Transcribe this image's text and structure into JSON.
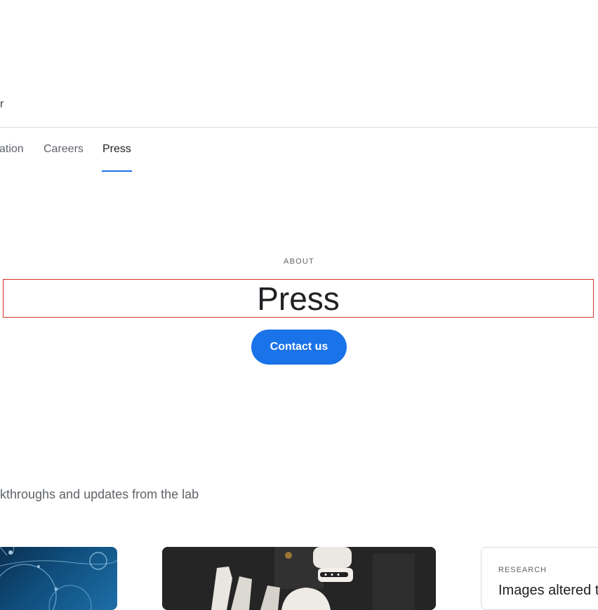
{
  "header": {
    "fragment": "r"
  },
  "nav": {
    "tabs": [
      {
        "label": "ation",
        "active": false
      },
      {
        "label": "Careers",
        "active": false
      },
      {
        "label": "Press",
        "active": true
      }
    ]
  },
  "hero": {
    "eyebrow": "ABOUT",
    "title": "Press",
    "cta_label": "Contact us"
  },
  "section": {
    "intro": "kthroughs and updates from the lab"
  },
  "cards": [
    {
      "image": "blue-network-illustration"
    },
    {
      "image": "robot-arm-photo"
    },
    {
      "tag": "RESEARCH",
      "title": "Images altered t"
    }
  ],
  "colors": {
    "accent": "#1a73e8",
    "text": "#202124",
    "muted": "#5f6368",
    "divider": "#dadce0",
    "highlight_border": "#d93025"
  }
}
